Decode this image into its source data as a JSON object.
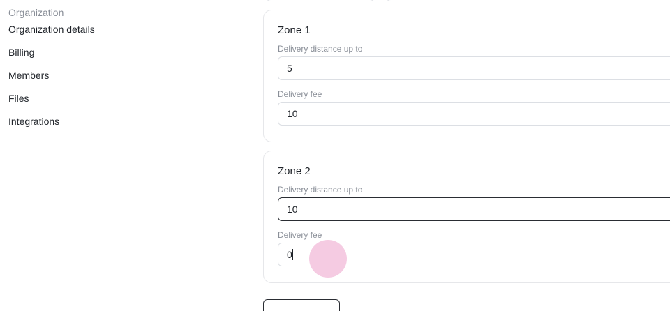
{
  "sidebar": {
    "heading": "Organization",
    "items": [
      {
        "label": "Organization details"
      },
      {
        "label": "Billing"
      },
      {
        "label": "Members"
      },
      {
        "label": "Files"
      },
      {
        "label": "Integrations"
      }
    ]
  },
  "zones": [
    {
      "title": "Zone 1",
      "distance_label": "Delivery distance up to",
      "distance_value": "5",
      "fee_label": "Delivery fee",
      "fee_value": "10"
    },
    {
      "title": "Zone 2",
      "distance_label": "Delivery distance up to",
      "distance_value": "10",
      "fee_label": "Delivery fee",
      "fee_value": "0"
    }
  ],
  "colors": {
    "click_indicator": "#e88cbe",
    "border": "#e6e7ea",
    "focused_border": "#2a2d33",
    "muted_text": "#8a8f98"
  }
}
